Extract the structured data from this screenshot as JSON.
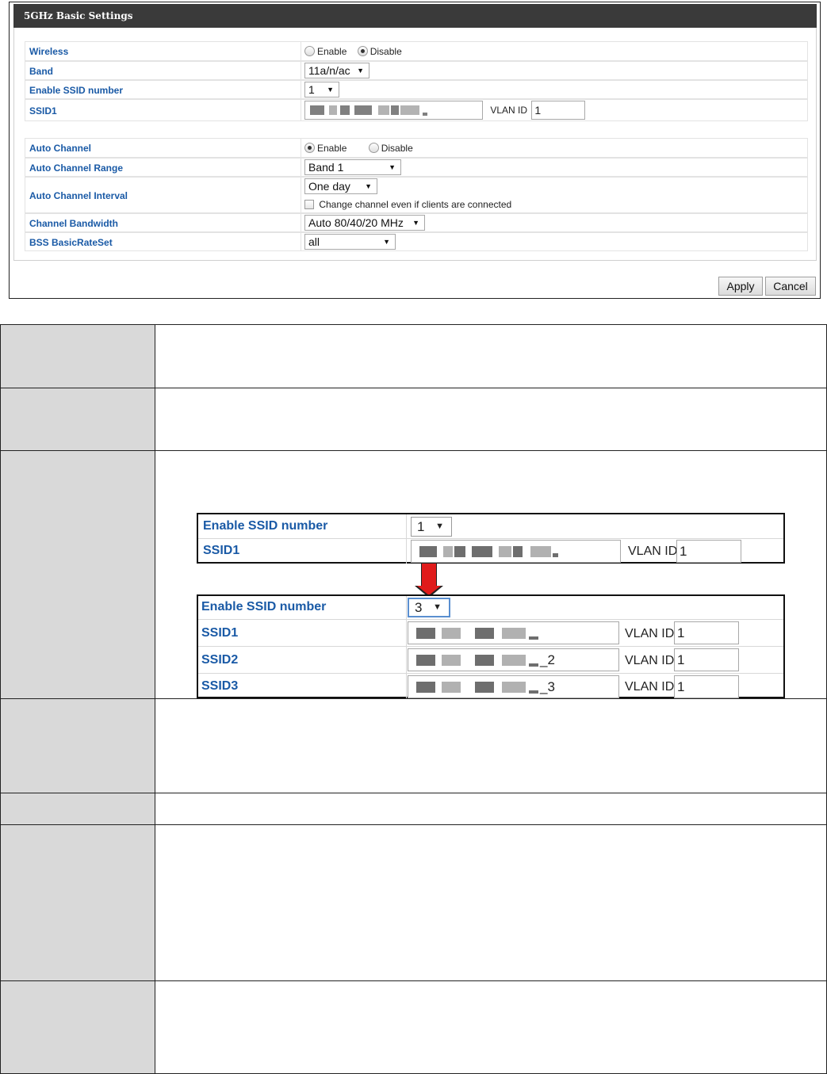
{
  "panel": {
    "title": "5GHz Basic Settings",
    "wireless": {
      "label": "Wireless",
      "options": [
        "Enable",
        "Disable"
      ],
      "selected": "Disable"
    },
    "band": {
      "label": "Band",
      "value": "11a/n/ac"
    },
    "ssid_number": {
      "label": "Enable SSID number",
      "value": "1"
    },
    "ssid1": {
      "label": "SSID1",
      "vlan_label": "VLAN ID",
      "vlan_value": "1"
    },
    "auto_channel": {
      "label": "Auto Channel",
      "options": [
        "Enable",
        "Disable"
      ],
      "selected": "Enable"
    },
    "auto_channel_range": {
      "label": "Auto Channel Range",
      "value": "Band 1"
    },
    "auto_channel_interval": {
      "label": "Auto Channel Interval",
      "value": "One day",
      "checkbox_label": "Change channel even if clients are connected",
      "checkbox_checked": false
    },
    "channel_bandwidth": {
      "label": "Channel Bandwidth",
      "value": "Auto 80/40/20 MHz"
    },
    "bss_basic_rate_set": {
      "label": "BSS BasicRateSet",
      "value": "all"
    },
    "apply_label": "Apply",
    "cancel_label": "Cancel"
  },
  "illustration": {
    "before": {
      "ssid_number_label": "Enable SSID number",
      "ssid_number_value": "1",
      "rows": [
        {
          "label": "SSID1",
          "suffix": "",
          "vlan_label": "VLAN ID",
          "vlan_value": "1"
        }
      ]
    },
    "after": {
      "ssid_number_label": "Enable SSID number",
      "ssid_number_value": "3",
      "rows": [
        {
          "label": "SSID1",
          "suffix": "",
          "vlan_label": "VLAN ID",
          "vlan_value": "1"
        },
        {
          "label": "SSID2",
          "suffix": "_2",
          "vlan_label": "VLAN ID",
          "vlan_value": "1"
        },
        {
          "label": "SSID3",
          "suffix": "_3",
          "vlan_label": "VLAN ID",
          "vlan_value": "1"
        }
      ]
    },
    "arrow_color": "#e01b1b"
  },
  "colors": {
    "label_blue": "#1a5aa6",
    "header_bg": "#3a3a3a",
    "table_label_bg": "#d9d9d9"
  }
}
